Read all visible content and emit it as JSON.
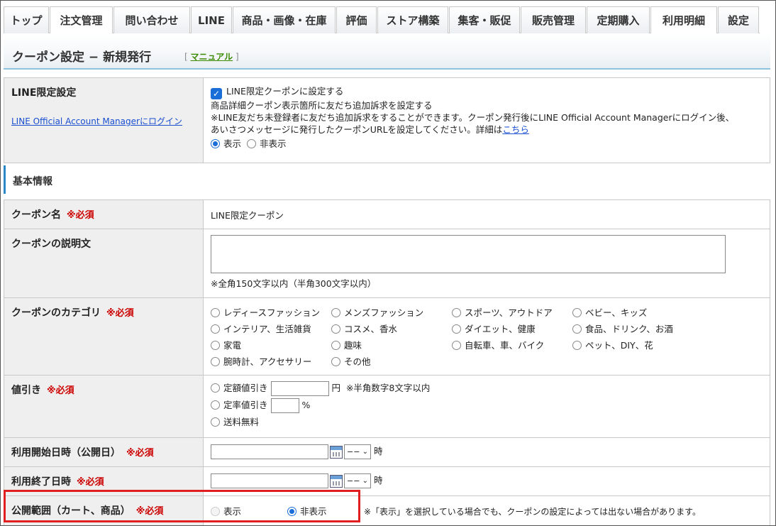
{
  "tabs": [
    "トップ",
    "注文管理",
    "問い合わせ",
    "LINE",
    "商品・画像・在庫",
    "評価",
    "ストア構築",
    "集客・販促",
    "販売管理",
    "定期購入",
    "利用明細",
    "設定"
  ],
  "page": {
    "title": "クーポン設定 − 新規発行",
    "manual_open": "[",
    "manual_label": "マニュアル",
    "manual_close": "]"
  },
  "line_section": {
    "label": "LINE限定設定",
    "login_link": "LINE Official Account Managerにログイン",
    "checkbox_label": "LINE限定クーポンに設定する",
    "desc1": "商品詳細クーポン表示箇所に友だち追加訴求を設定する",
    "desc2": "※LINE友だち未登録者に友だち追加訴求をすることができます。クーポン発行後にLINE Official Account Managerにログイン後、",
    "desc3": "あいさつメッセージに発行したクーポンURLを設定してください。詳細は",
    "desc3_link": "こちら",
    "radio_show": "表示",
    "radio_hide": "非表示"
  },
  "basic_section": {
    "heading": "基本情報",
    "required": "※必須",
    "coupon_name_label": "クーポン名",
    "coupon_name_value": "LINE限定クーポン",
    "description_label": "クーポンの説明文",
    "description_hint": "※全角150文字以内（半角300文字以内）",
    "category_label": "クーポンのカテゴリ",
    "categories": [
      "レディースファッション",
      "メンズファッション",
      "スポーツ、アウトドア",
      "ベビー、キッズ",
      "インテリア、生活雑貨",
      "コスメ、香水",
      "ダイエット、健康",
      "食品、ドリンク、お酒",
      "家電",
      "趣味",
      "自転車、車、バイク",
      "ペット、DIY、花",
      "腕時計、アクセサリー",
      "その他"
    ],
    "discount_label": "値引き",
    "discount_fixed": "定額値引き",
    "discount_fixed_unit": "円",
    "discount_fixed_hint": "※半角数字8文字以内",
    "discount_rate": "定率値引き",
    "discount_rate_unit": "%",
    "free_shipping": "送料無料",
    "start_label": "利用開始日時（公開日）",
    "end_label": "利用終了日時",
    "select_value": "−−",
    "hour_unit": "時",
    "scope_label": "公開範囲（カート、商品）",
    "scope_show": "表示",
    "scope_hide": "非表示",
    "scope_note": "※「表示」を選択している場合でも、クーポンの設定によっては出ない場合があります。"
  },
  "icons": [
    "checkbox-checked-icon",
    "calendar-icon",
    "chevron-down-icon"
  ],
  "colors": {
    "accent": "#1a6ed8",
    "required": "#cc0000",
    "highlight": "#e02020",
    "link": "#1a4fd0",
    "manual_link": "#3a8a00"
  }
}
